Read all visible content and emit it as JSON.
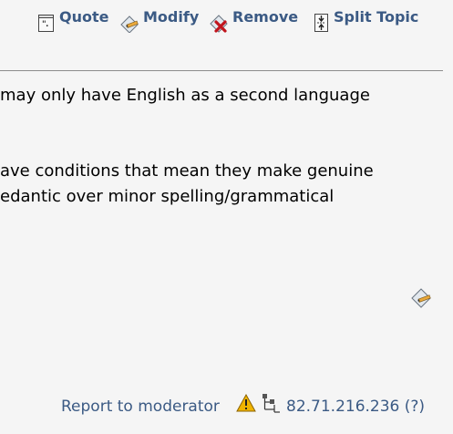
{
  "toolbar": {
    "quote_label": "Quote",
    "modify_label": "Modify",
    "remove_label": "Remove",
    "split_label": "Split Topic",
    "icons": {
      "quote": "quote-icon",
      "modify": "modify-icon",
      "remove": "remove-icon",
      "split": "split-topic-icon"
    }
  },
  "post": {
    "lines": [
      " may only have English as a second language",
      "ave conditions that mean they make genuine",
      "edantic over minor spelling/grammatical"
    ],
    "inline_modify_icon": "modify-icon"
  },
  "footer": {
    "report_label": "Report to moderator",
    "warning_icon": "warning-icon",
    "ip_icon": "ip-tree-icon",
    "ip_text": "82.71.216.236 (?)"
  },
  "colors": {
    "link": "#3b5a84",
    "background": "#f5f5f5",
    "divider": "#8c8c8c",
    "warning": "#f0b400",
    "remove_x": "#c0141c"
  }
}
